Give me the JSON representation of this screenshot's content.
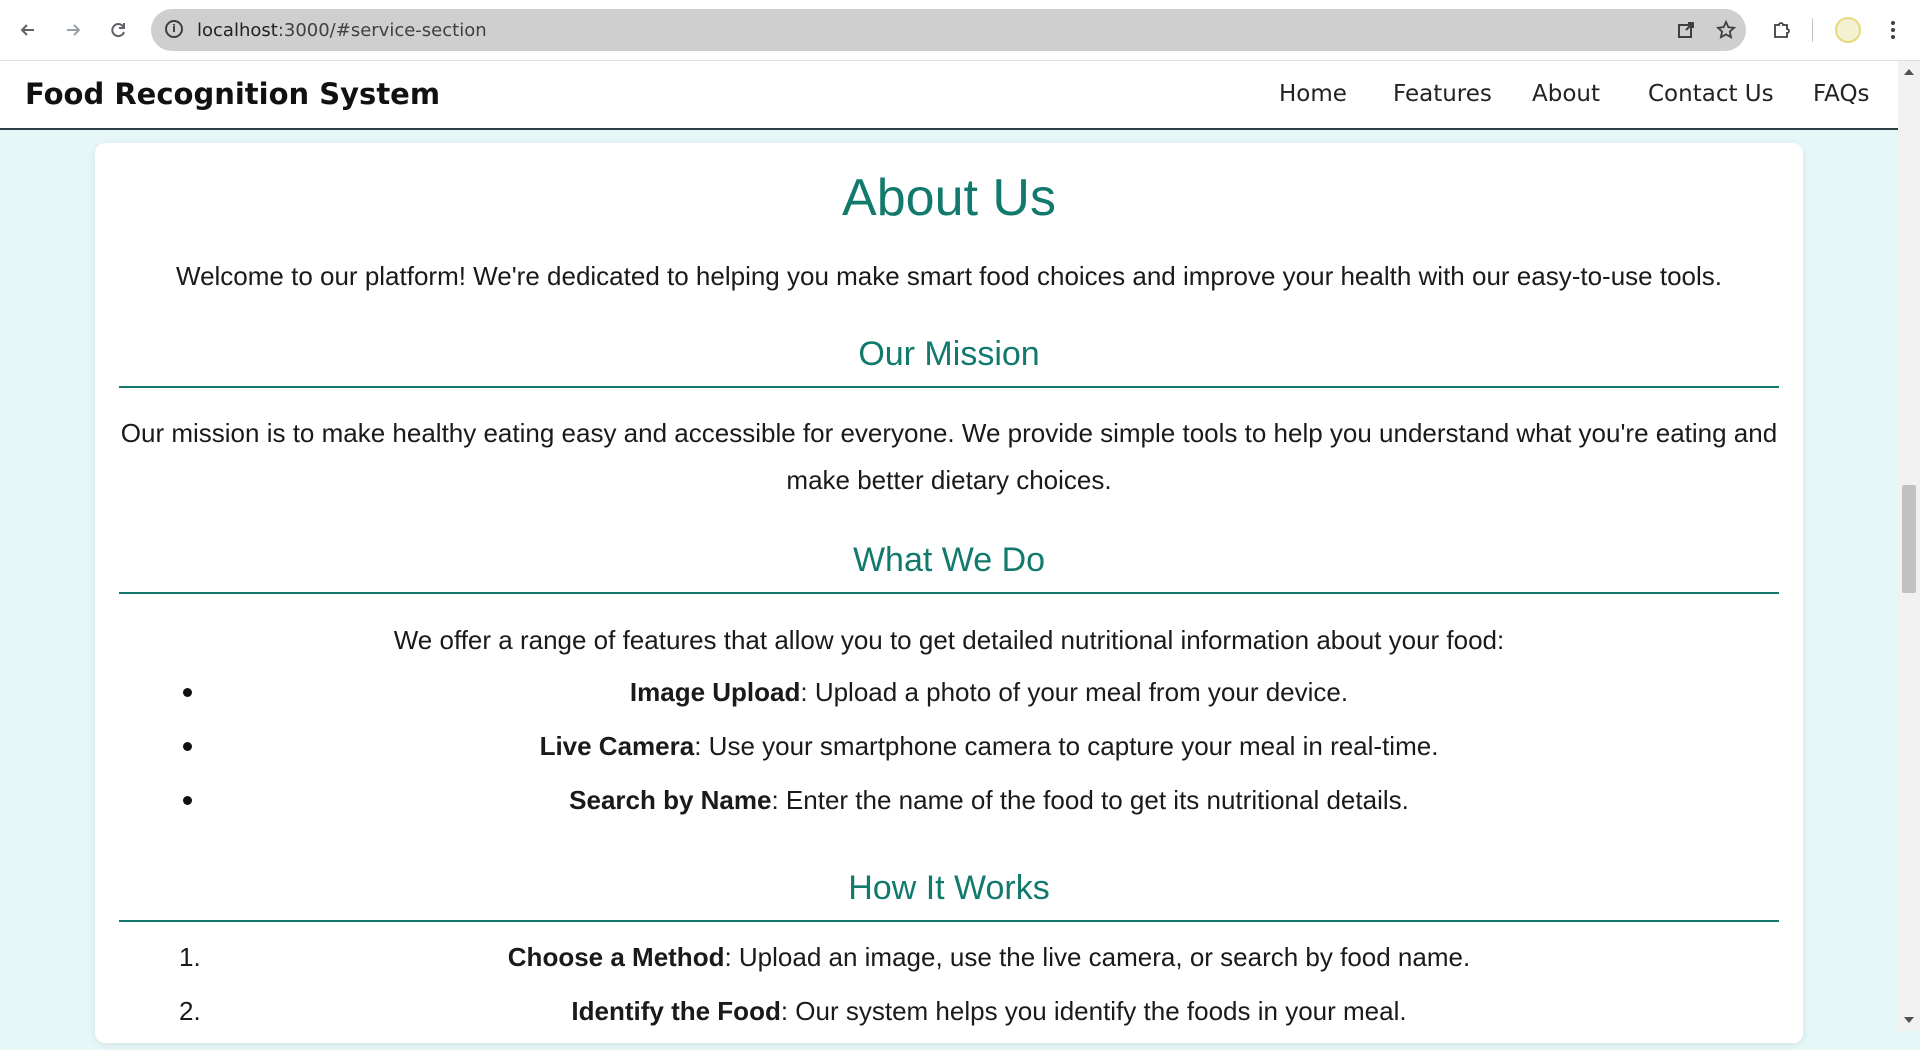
{
  "browser": {
    "url_host": "localhost",
    "url_rest": ":3000/#service-section"
  },
  "navbar": {
    "brand": "Food Recognition System",
    "links": [
      "Home",
      "Features",
      "About",
      "Contact Us",
      "FAQs"
    ]
  },
  "about": {
    "title": "About Us",
    "intro": "Welcome to our platform! We're dedicated to helping you make smart food choices and improve your health with our easy-to-use tools.",
    "mission": {
      "heading": "Our Mission",
      "line1": "Our mission is to make healthy eating easy and accessible for everyone. We provide simple tools to help you understand what you're eating and",
      "line2": "make better dietary choices."
    },
    "what_we_do": {
      "heading": "What We Do",
      "intro": "We offer a range of features that allow you to get detailed nutritional information about your food:",
      "items": [
        {
          "title": "Image Upload",
          "desc": ": Upload a photo of your meal from your device."
        },
        {
          "title": "Live Camera",
          "desc": ": Use your smartphone camera to capture your meal in real-time."
        },
        {
          "title": "Search by Name",
          "desc": ": Enter the name of the food to get its nutritional details."
        }
      ]
    },
    "how_it_works": {
      "heading": "How It Works",
      "steps": [
        {
          "number": "1.",
          "title": "Choose a Method",
          "desc": ": Upload an image, use the live camera, or search by food name."
        },
        {
          "number": "2.",
          "title": "Identify the Food",
          "desc": ": Our system helps you identify the foods in your meal."
        }
      ]
    }
  },
  "colors": {
    "accent": "#127a6c",
    "page_background": "#e6f7f8",
    "text": "#1a1a1a"
  }
}
